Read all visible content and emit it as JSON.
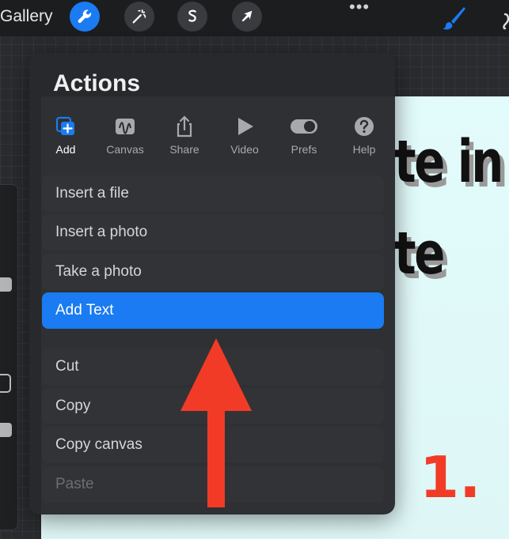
{
  "topbar": {
    "gallery_label": "Gallery",
    "tools": [
      {
        "name": "actions",
        "icon": "wrench-icon",
        "active": true
      },
      {
        "name": "adjustments",
        "icon": "magic-wand-icon",
        "active": false
      },
      {
        "name": "selection",
        "icon": "selection-s-icon",
        "active": false
      },
      {
        "name": "transform",
        "icon": "arrow-cursor-icon",
        "active": false
      }
    ],
    "more_label": "•••",
    "right_tools": [
      {
        "name": "brush",
        "icon": "brush-icon",
        "color": "#1a7bf2"
      },
      {
        "name": "smudge",
        "icon": "smudge-icon"
      }
    ]
  },
  "actions": {
    "title": "Actions",
    "tabs": [
      {
        "label": "Add",
        "icon": "add-square-icon",
        "active": true
      },
      {
        "label": "Canvas",
        "icon": "canvas-wave-icon",
        "active": false
      },
      {
        "label": "Share",
        "icon": "share-icon",
        "active": false
      },
      {
        "label": "Video",
        "icon": "play-icon",
        "active": false
      },
      {
        "label": "Prefs",
        "icon": "toggle-icon",
        "active": false
      },
      {
        "label": "Help",
        "icon": "help-icon",
        "active": false
      }
    ],
    "items": [
      {
        "label": "Insert a file",
        "state": "normal"
      },
      {
        "label": "Insert a photo",
        "state": "normal"
      },
      {
        "label": "Take a photo",
        "state": "normal"
      },
      {
        "label": "Add Text",
        "state": "selected"
      },
      {
        "label": "Cut",
        "state": "normal"
      },
      {
        "label": "Copy",
        "state": "normal"
      },
      {
        "label": "Copy canvas",
        "state": "normal"
      },
      {
        "label": "Paste",
        "state": "disabled"
      }
    ]
  },
  "canvas": {
    "line1": "te in",
    "line2": "te",
    "step_number": "1."
  },
  "colors": {
    "accent": "#1a7bf2",
    "annotation_arrow": "#f23b26"
  }
}
